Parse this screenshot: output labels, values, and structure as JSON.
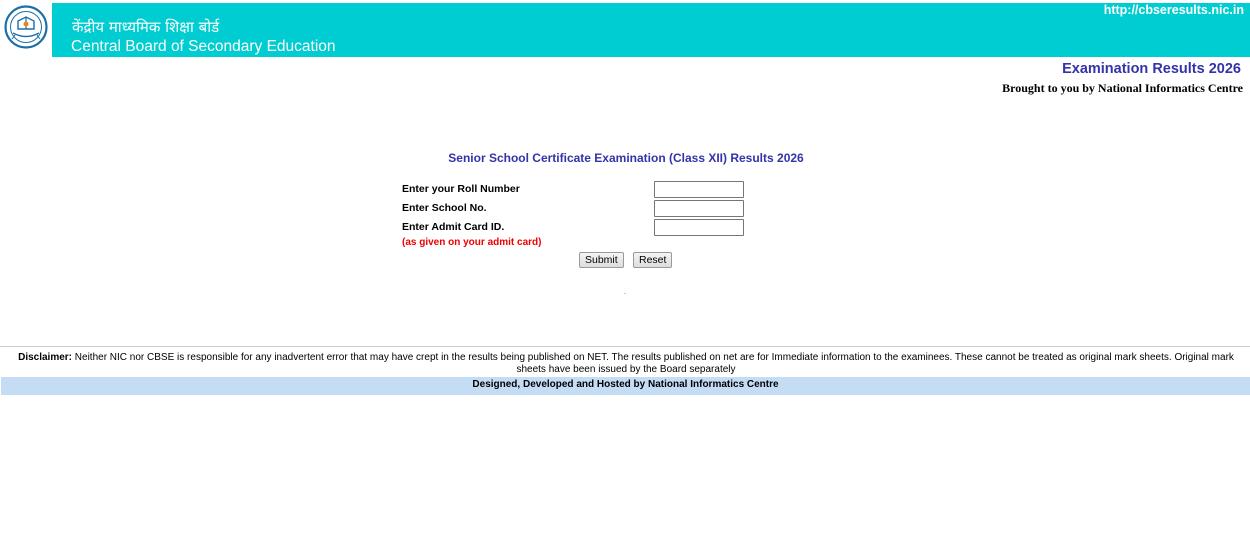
{
  "header": {
    "title_hindi": "केंद्रीय माध्यमिक शिक्षा बोर्ड",
    "title_english": "Central Board of Secondary Education",
    "url": "http://cbseresults.nic.in",
    "banner_color": "#00cdd2"
  },
  "exam": {
    "title": "Examination Results 2026",
    "brought_by": "Brought to you by National Informatics Centre"
  },
  "form": {
    "title": "Senior School Certificate Examination (Class XII) Results 2026",
    "roll_label": "Enter your Roll Number",
    "roll_value": "",
    "school_label": "Enter School No.",
    "school_value": "",
    "admit_label": "Enter Admit Card ID.",
    "admit_value": "",
    "admit_note": "(as given on your admit card)",
    "submit_label": "Submit",
    "reset_label": "Reset"
  },
  "footer": {
    "disclaimer_label": "Disclaimer:",
    "disclaimer_text": " Neither NIC nor CBSE is responsible for any inadvertent error that may have crept in the results being published on NET. The results published on net are for Immediate information to the examinees. These cannot be treated as original mark sheets. Original mark sheets have been issued by the Board separately",
    "designed_by": "Designed, Developed and Hosted by National Informatics Centre",
    "designed_bar_color": "#c5dcf5"
  },
  "icons": {
    "logo": "cbse-emblem-icon"
  }
}
